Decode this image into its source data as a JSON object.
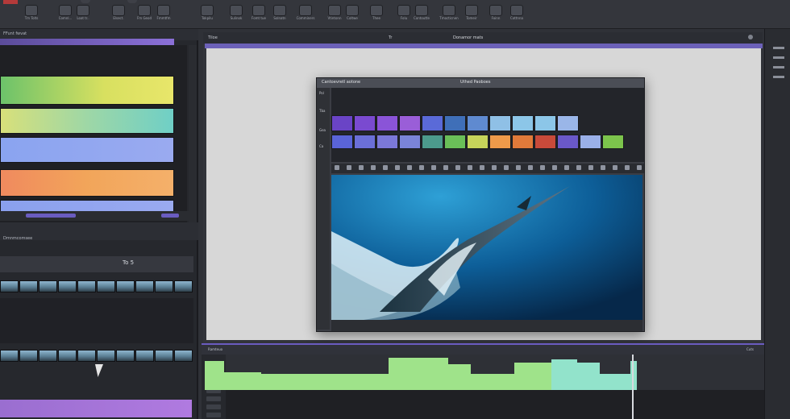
{
  "toolbar": {
    "items": [
      {
        "icon": "move-icon",
        "label": "Tm Tolts"
      },
      {
        "icon": "layers-icon",
        "label": "Comnl..."
      },
      {
        "icon": "grid-icon",
        "label": "Loat tr.."
      },
      {
        "icon": "record-icon",
        "label": "Elsect."
      },
      {
        "icon": "film-icon",
        "label": "Fm Geod"
      },
      {
        "icon": "film-icon",
        "label": "Fmmtfm"
      },
      {
        "icon": "link-icon",
        "label": "Tokpilu"
      },
      {
        "icon": "drop-icon",
        "label": "Sulinok"
      },
      {
        "icon": "pen-icon",
        "label": "Fomt tue"
      },
      {
        "icon": "crop-icon",
        "label": "Solnatn"
      },
      {
        "icon": "slider-icon",
        "label": "Comminers"
      },
      {
        "icon": "clock-icon",
        "label": "Vtintonn"
      },
      {
        "icon": "brush-icon",
        "label": "Coltwe"
      },
      {
        "icon": "monitor-icon",
        "label": "Thee"
      },
      {
        "icon": "gear-icon",
        "label": "Folu"
      },
      {
        "icon": "circle-icon",
        "label": "Contoutte"
      },
      {
        "icon": "display-icon",
        "label": "Tmocticnen"
      },
      {
        "icon": "split-icon",
        "label": "Tomeir"
      },
      {
        "icon": "window-icon",
        "label": "Foinn"
      },
      {
        "icon": "list-icon",
        "label": "Cottnna"
      }
    ]
  },
  "left_panel": {
    "header_label": "FFunt  fwvat",
    "mid_label": "Dmnmcomsee",
    "clip_bin_title": "To 5"
  },
  "viewer": {
    "tab_1": "Tiloe",
    "tab_2": "Tr",
    "title": "Donamor mats"
  },
  "inner_window": {
    "head_left": "Cantoevretl aotone",
    "head_right": "Uthed Paoboes",
    "side_labels": [
      "Pol",
      "Tba",
      "Gea",
      "Ca"
    ]
  },
  "timeline": {
    "left_label": "Ramteuo",
    "right_label": "Cuts"
  },
  "colors": {
    "accent": "#6c61b8",
    "waveform": "#9fe38a",
    "waveform_cyan": "#8fe3d6",
    "band_yellow_green": "#d8e060",
    "band_teal": "#6fcfc6",
    "band_lavender": "#9aaaf0",
    "band_orange": "#f2a55a"
  }
}
